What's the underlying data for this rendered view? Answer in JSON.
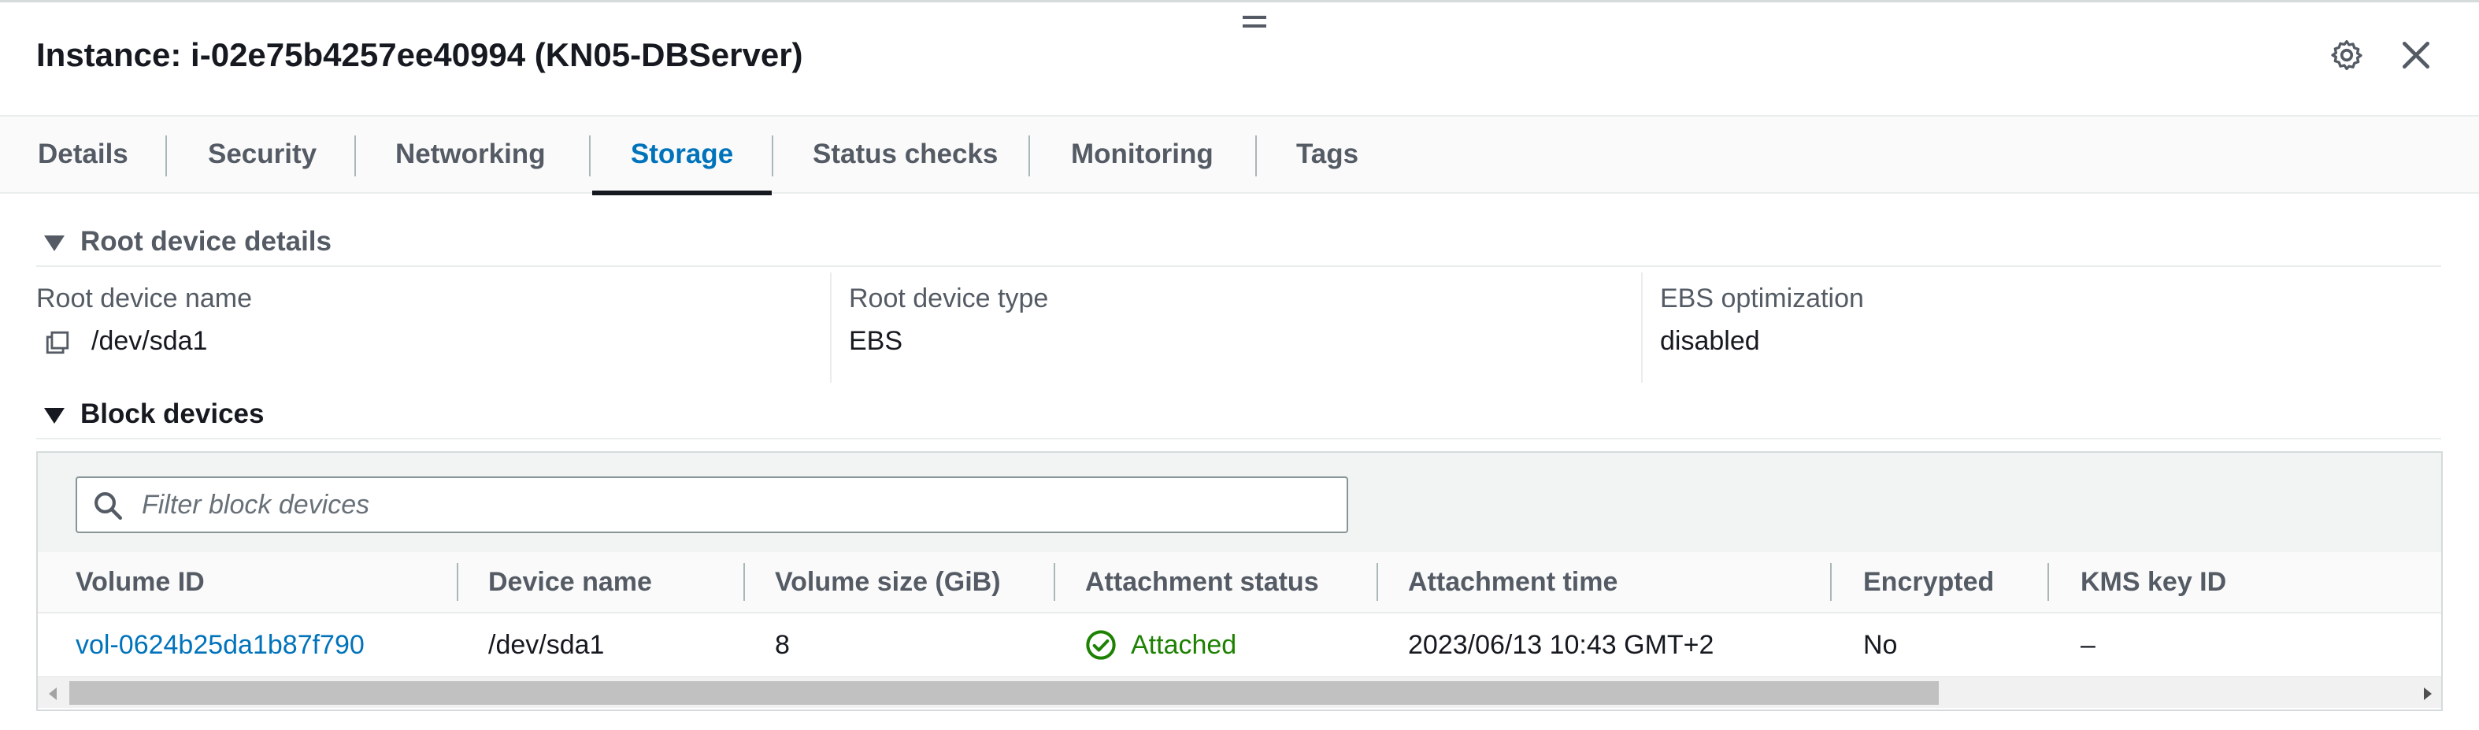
{
  "header": {
    "title": "Instance: i-02e75b4257ee40994 (KN05-DBServer)",
    "icons": [
      "drag-handle-icon",
      "gear-icon",
      "close-icon"
    ]
  },
  "tabs": [
    {
      "label": "Details",
      "active": false
    },
    {
      "label": "Security",
      "active": false
    },
    {
      "label": "Networking",
      "active": false
    },
    {
      "label": "Storage",
      "active": true
    },
    {
      "label": "Status checks",
      "active": false
    },
    {
      "label": "Monitoring",
      "active": false
    },
    {
      "label": "Tags",
      "active": false
    }
  ],
  "root_device": {
    "section_title": "Root device details",
    "name_label": "Root device name",
    "name_value": "/dev/sda1",
    "type_label": "Root device type",
    "type_value": "EBS",
    "ebs_label": "EBS optimization",
    "ebs_value": "disabled"
  },
  "block_devices": {
    "section_title": "Block devices",
    "filter_placeholder": "Filter block devices",
    "columns": [
      "Volume ID",
      "Device name",
      "Volume size (GiB)",
      "Attachment status",
      "Attachment time",
      "Encrypted",
      "KMS key ID"
    ],
    "rows": [
      {
        "volume_id": "vol-0624b25da1b87f790",
        "device_name": "/dev/sda1",
        "volume_size": "8",
        "attachment_status": "Attached",
        "attachment_time": "2023/06/13 10:43 GMT+2",
        "encrypted": "No",
        "kms_key_id": "–"
      }
    ]
  },
  "colors": {
    "link": "#0073bb",
    "active_tab": "#0073bb",
    "status_ok": "#1d8102",
    "text_secondary": "#545b64"
  }
}
